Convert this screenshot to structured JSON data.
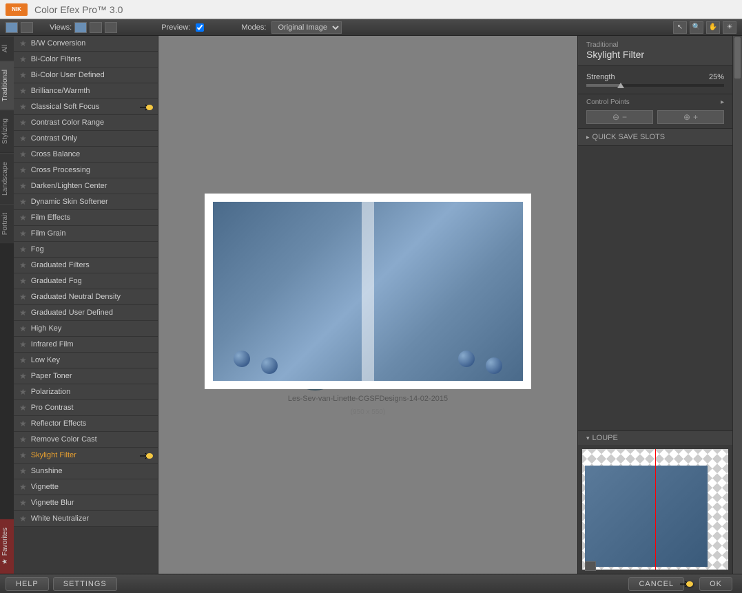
{
  "app": {
    "title": "Color Efex Pro™ 3.0",
    "logo": "NIK"
  },
  "toolbar": {
    "views_label": "Views:",
    "preview_label": "Preview:",
    "preview_checked": true,
    "modes_label": "Modes:",
    "mode_value": "Original Image"
  },
  "side_tabs": [
    "All",
    "Traditional",
    "Stylizing",
    "Landscape",
    "Portrait"
  ],
  "active_side_tab": "Traditional",
  "favorites_label": "Favorites",
  "filters": [
    "B/W Conversion",
    "Bi-Color Filters",
    "Bi-Color User Defined",
    "Brilliance/Warmth",
    "Classical Soft Focus",
    "Contrast Color Range",
    "Contrast Only",
    "Cross Balance",
    "Cross Processing",
    "Darken/Lighten Center",
    "Dynamic Skin Softener",
    "Film Effects",
    "Film Grain",
    "Fog",
    "Graduated Filters",
    "Graduated Fog",
    "Graduated Neutral Density",
    "Graduated User Defined",
    "High Key",
    "Infrared Film",
    "Low Key",
    "Paper Toner",
    "Polarization",
    "Pro Contrast",
    "Reflector Effects",
    "Remove Color Cast",
    "Skylight Filter",
    "Sunshine",
    "Vignette",
    "Vignette Blur",
    "White Neutralizer"
  ],
  "selected_filter": "Skylight Filter",
  "canvas": {
    "filename": "Les-Sev-van-Linette-CGSFDesigns-14-02-2015",
    "dimensions": "(950 x 550)"
  },
  "panel": {
    "category": "Traditional",
    "title": "Skylight Filter",
    "strength_label": "Strength",
    "strength_value": "25%",
    "control_points_label": "Control Points",
    "quick_save_label": "QUICK SAVE SLOTS",
    "loupe_label": "LOUPE"
  },
  "bottom": {
    "help": "HELP",
    "settings": "SETTINGS",
    "cancel": "CANCEL",
    "ok": "OK"
  }
}
